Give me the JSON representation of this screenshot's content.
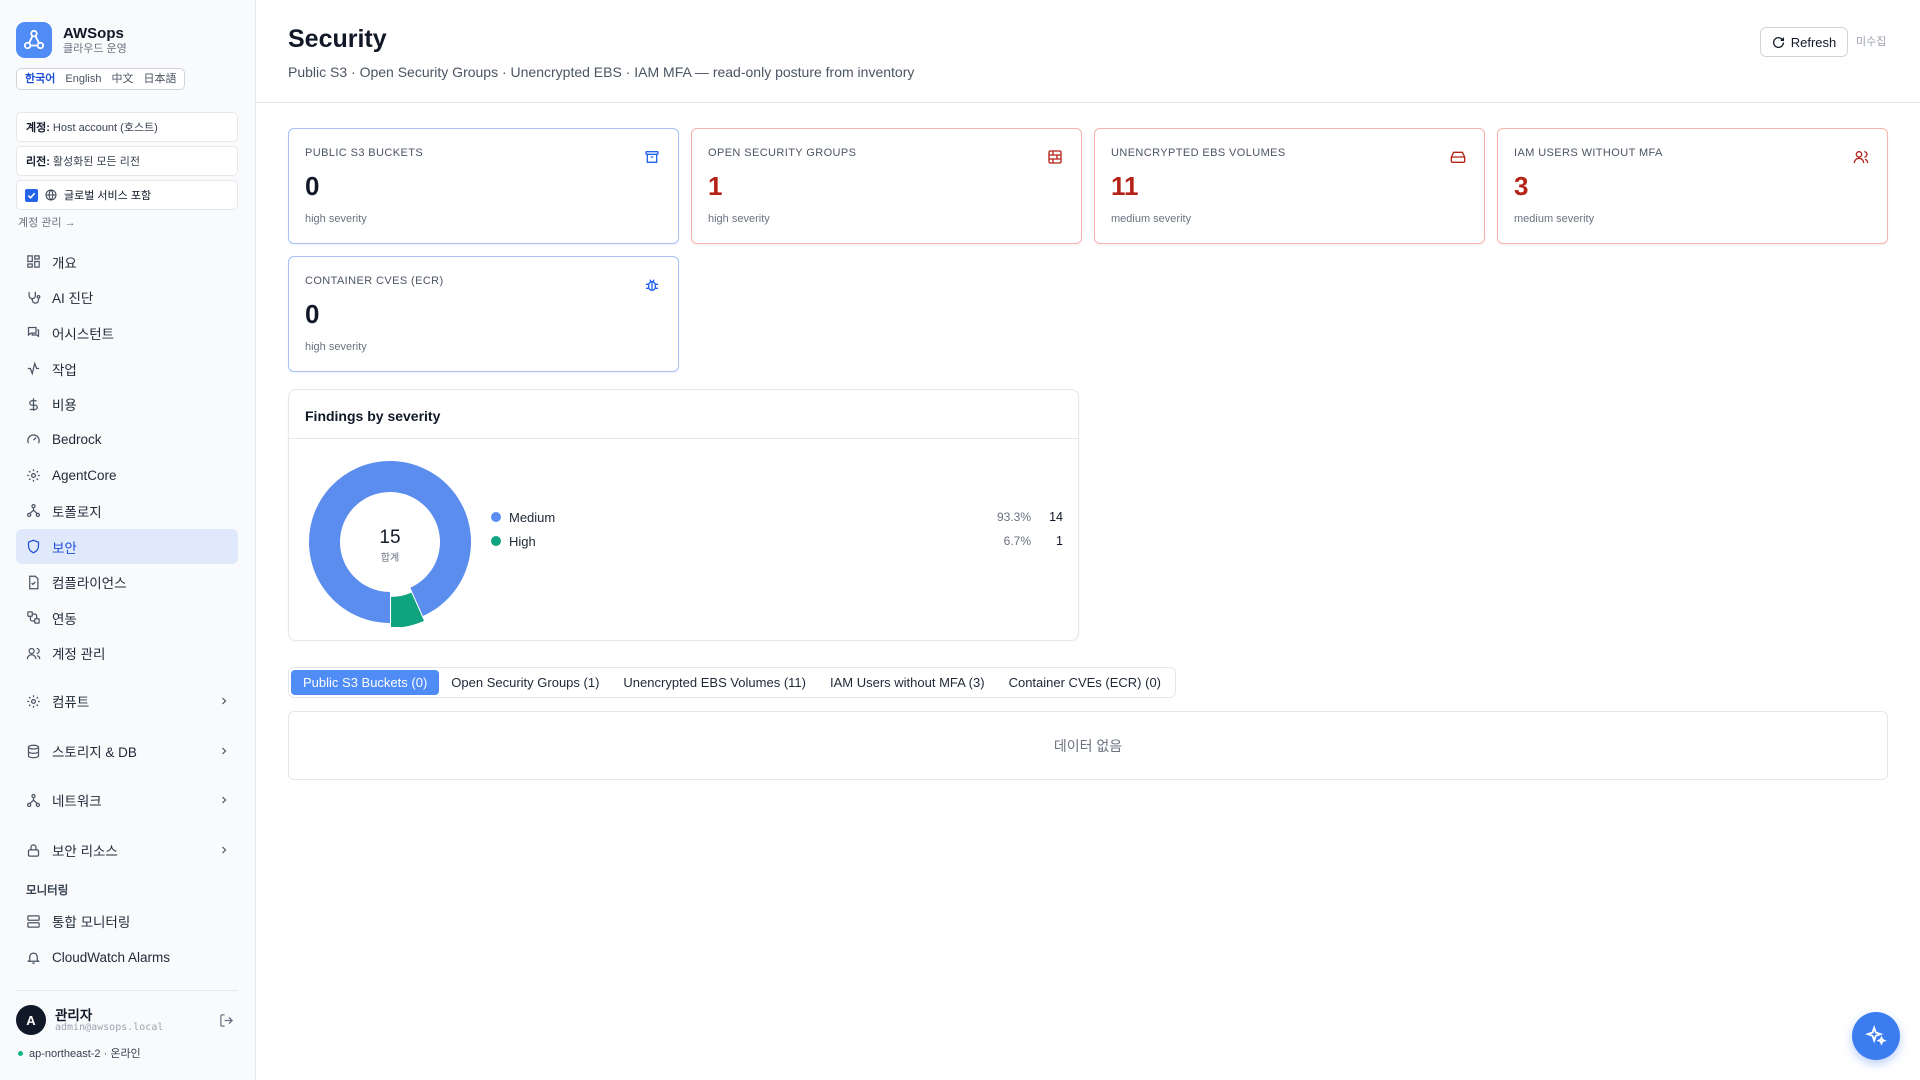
{
  "brand": {
    "name": "AWSops",
    "subtitle": "클라우드 운영"
  },
  "languages": [
    "한국어",
    "English",
    "中文",
    "日本語"
  ],
  "account": {
    "label": "계정:",
    "value": "Host account (호스트)"
  },
  "region": {
    "label": "리전:",
    "value": "활성화된 모든 리전"
  },
  "global_services": {
    "label": "글로벌 서비스 포함",
    "checked": true
  },
  "account_manage_link": "계정 관리 →",
  "nav": [
    {
      "label": "개요",
      "icon": "dashboard-icon"
    },
    {
      "label": "AI 진단",
      "icon": "stethoscope-icon"
    },
    {
      "label": "어시스턴트",
      "icon": "chat-icon"
    },
    {
      "label": "작업",
      "icon": "activity-icon"
    },
    {
      "label": "비용",
      "icon": "dollar-icon"
    },
    {
      "label": "Bedrock",
      "icon": "gauge-icon"
    },
    {
      "label": "AgentCore",
      "icon": "cpu-icon"
    },
    {
      "label": "토폴로지",
      "icon": "topology-icon"
    },
    {
      "label": "보안",
      "icon": "shield-icon",
      "active": true
    },
    {
      "label": "컴플라이언스",
      "icon": "compliance-icon"
    },
    {
      "label": "연동",
      "icon": "integration-icon"
    },
    {
      "label": "계정 관리",
      "icon": "users-icon"
    }
  ],
  "nav_groups": [
    {
      "label": "컴퓨트",
      "icon": "cpu-icon"
    },
    {
      "label": "스토리지 & DB",
      "icon": "database-icon"
    },
    {
      "label": "네트워크",
      "icon": "network-icon"
    },
    {
      "label": "보안 리소스",
      "icon": "lock-icon"
    }
  ],
  "monitoring": {
    "label": "모니터링",
    "items": [
      {
        "label": "통합 모니터링",
        "icon": "server-icon"
      },
      {
        "label": "CloudWatch Alarms",
        "icon": "bell-icon"
      }
    ]
  },
  "user": {
    "initial": "A",
    "name": "관리자",
    "email": "admin@awsops.local",
    "status": "ap-northeast-2 · 온라인"
  },
  "header": {
    "title": "Security",
    "subtitle": "Public S3 · Open Security Groups · Unencrypted EBS · IAM MFA — read-only posture from inventory",
    "refresh_label": "Refresh",
    "status": "미수집"
  },
  "cards": [
    {
      "label": "PUBLIC S3 BUCKETS",
      "value": "0",
      "severity": "high severity",
      "icon": "archive-icon",
      "tone": "blue"
    },
    {
      "label": "OPEN SECURITY GROUPS",
      "value": "1",
      "severity": "high severity",
      "icon": "firewall-icon",
      "tone": "red"
    },
    {
      "label": "UNENCRYPTED EBS VOLUMES",
      "value": "11",
      "severity": "medium severity",
      "icon": "hard-drive-icon",
      "tone": "red"
    },
    {
      "label": "IAM USERS WITHOUT MFA",
      "value": "3",
      "severity": "medium severity",
      "icon": "users-icon",
      "tone": "red"
    },
    {
      "label": "CONTAINER CVES (ECR)",
      "value": "0",
      "severity": "high severity",
      "icon": "bug-icon",
      "tone": "blue"
    }
  ],
  "colors": {
    "accent": "#4f8cf6",
    "medium": "#5b8def",
    "high": "#10a37f",
    "danger": "#b42318"
  },
  "chart_data": {
    "type": "pie",
    "title": "Findings by severity",
    "total": 15,
    "total_label": "합계",
    "series": [
      {
        "name": "Medium",
        "value": 14,
        "percent": "93.3%",
        "color": "#5b8def"
      },
      {
        "name": "High",
        "value": 1,
        "percent": "6.7%",
        "color": "#10a37f"
      }
    ]
  },
  "tabs": [
    {
      "label": "Public S3 Buckets (0)",
      "active": true
    },
    {
      "label": "Open Security Groups (1)"
    },
    {
      "label": "Unencrypted EBS Volumes (11)"
    },
    {
      "label": "IAM Users without MFA (3)"
    },
    {
      "label": "Container CVEs (ECR) (0)"
    }
  ],
  "empty_message": "데이터 없음"
}
